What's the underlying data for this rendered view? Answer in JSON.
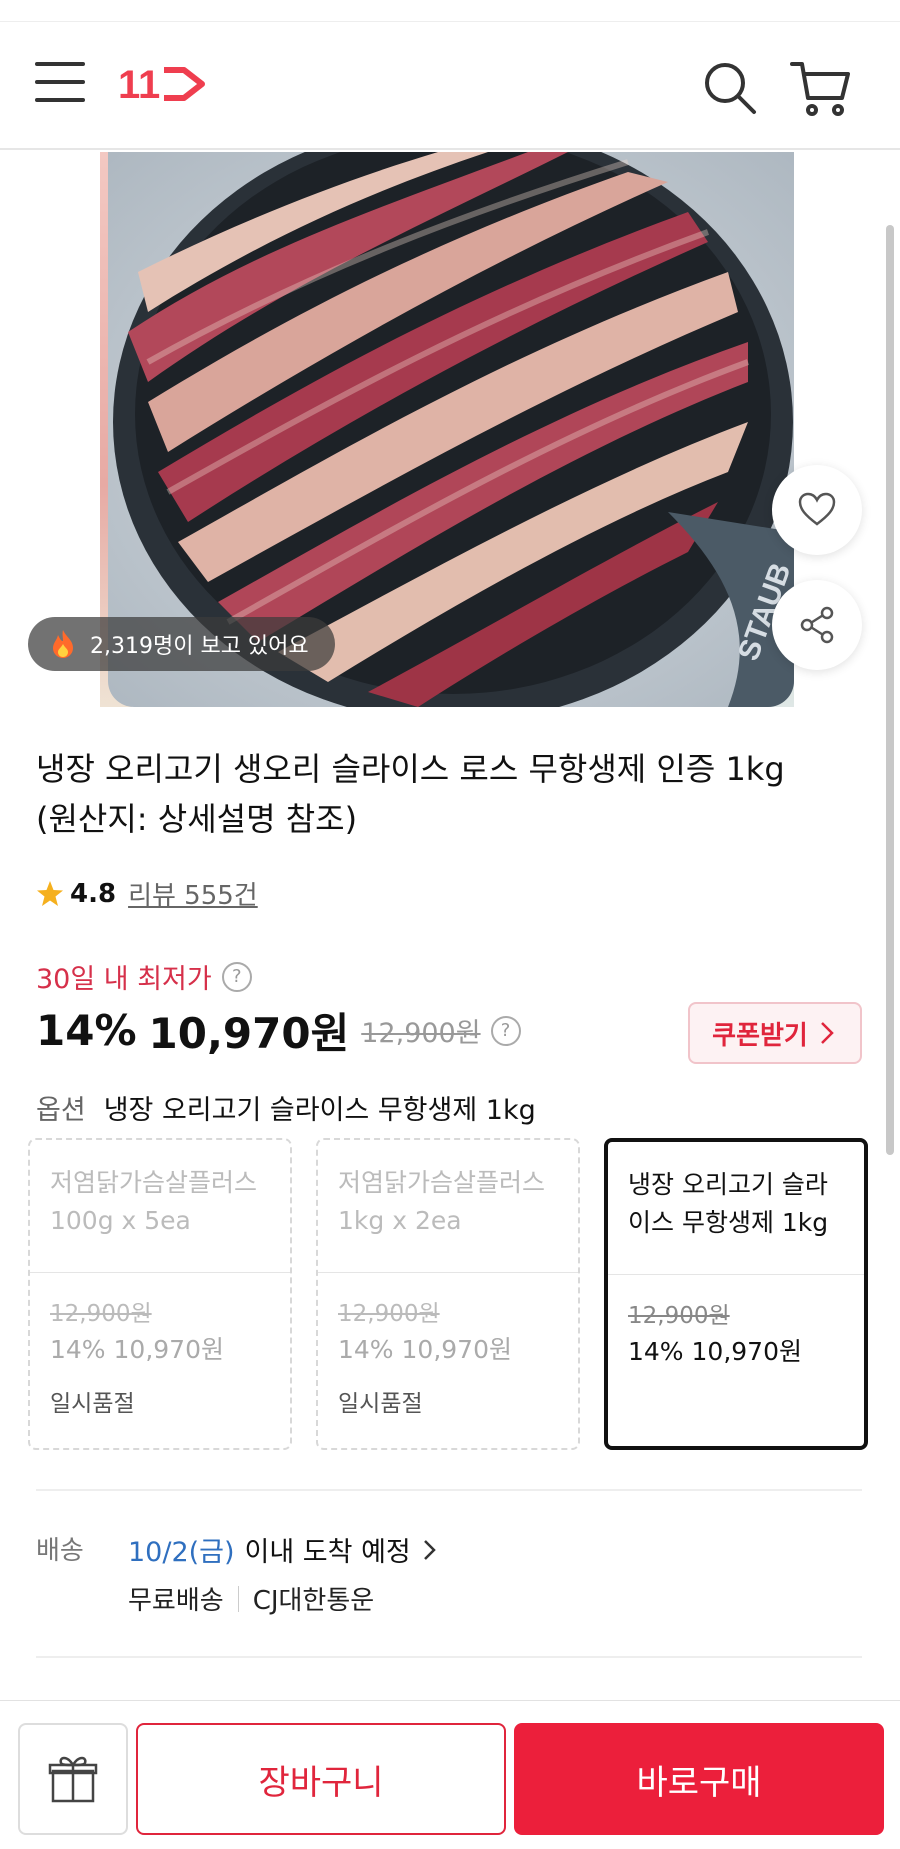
{
  "header": {
    "logo_text": "11"
  },
  "product": {
    "viewers_text": "2,319명이 보고 있어요",
    "title_line1": "냉장 오리고기 생오리 슬라이스 로스 무항생제 인증 1kg",
    "title_line2": "(원산지: 상세설명 참조)",
    "rating": "4.8",
    "reviews_text": "리뷰 555건",
    "lowest_label": "30일 내 최저가",
    "discount": "14%",
    "price": "10,970원",
    "original_price": "12,900원",
    "coupon_label": "쿠폰받기"
  },
  "options": {
    "label": "옵션",
    "selected": "냉장 오리고기 슬라이스 무항생제 1kg",
    "cards": [
      {
        "name": "저염닭가슴살플러스 100g x 5ea",
        "orig": "12,900원",
        "sale": "14% 10,970원",
        "stock": "일시품절"
      },
      {
        "name": "저염닭가슴살플러스 1kg x 2ea",
        "orig": "12,900원",
        "sale": "14% 10,970원",
        "stock": "일시품절"
      },
      {
        "name": "냉장 오리고기 슬라이스 무항생제 1kg",
        "orig": "12,900원",
        "sale": "14% 10,970원",
        "stock": ""
      }
    ]
  },
  "shipping": {
    "label": "배송",
    "date": "10/2(금)",
    "date_suffix": "이내 도착 예정",
    "free": "무료배송",
    "carrier": "CJ대한통운"
  },
  "bottom_bar": {
    "cart_label": "장바구니",
    "buy_label": "바로구매"
  },
  "colors": {
    "accent": "#e0253c",
    "link_blue": "#2f6fbf"
  }
}
